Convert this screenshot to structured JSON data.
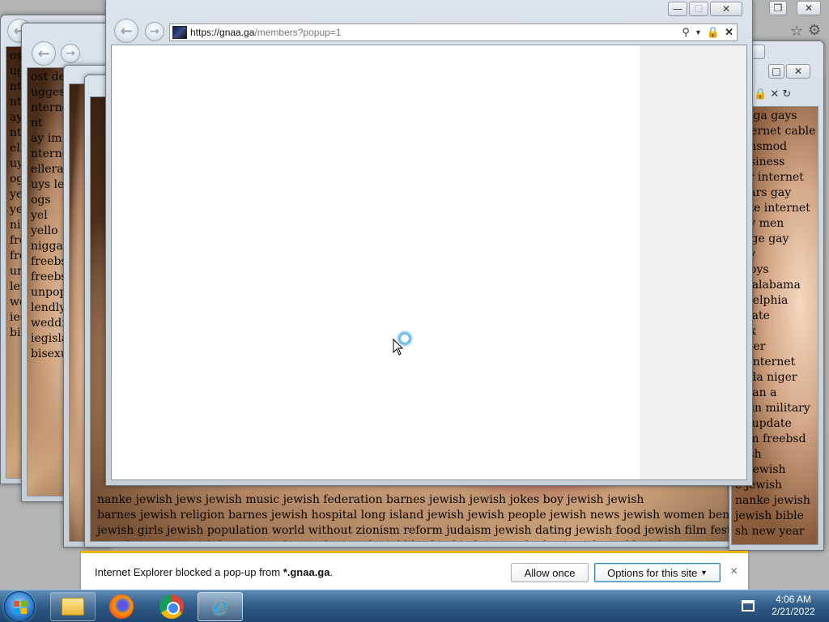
{
  "popup": {
    "url_host": "https://gnaa.ga",
    "url_path": "/members?popup=1",
    "caption": {
      "minimize": "—",
      "maximize": "☐",
      "close": "✕"
    }
  },
  "background_window": {
    "lines": [
      "nigga gays",
      "internet cable",
      "e insmod",
      "business",
      "ker internet",
      "bears gay",
      "note internet",
      "gay men",
      "riage gay",
      "gay",
      "y toys",
      "ay alabama",
      "ladelphia",
      "s hate",
      "nux",
      "niger",
      "st internet",
      "nada niger",
      "n can a",
      "ys in military",
      "sd update",
      "com freebsd",
      "wish",
      "al jewish",
      "e jewish",
      "nanke jewish",
      "jewish bible",
      "sh new year"
    ],
    "bottom_lines": [
      "nanke jewish jews jewish music jewish federation barnes jewish jewish jokes boy jewish jewish",
      "barnes jewish religion barnes jewish hospital long island jewish jewish people jewish news jewish women ben bernanke jewish",
      "jewish girls jewish population world without zionism reform judaism jewish dating jewish food jewish film festival jewish bible",
      "jewish names jewish last names bernanke jew daniel libeskind judaism orthodox jewish world without zionism jewish new year"
    ],
    "left_lines": [
      "ost de",
      "ugges",
      "nterne",
      "nt",
      "ay im",
      "nterne",
      "ellera",
      "uys le",
      "ogs",
      "yel",
      "yello",
      "nigga g",
      "freebs",
      "freebs",
      "unpopi",
      "lendly",
      "wedding",
      "iegislat",
      "bisexua"
    ]
  },
  "notification": {
    "message_prefix": "Internet Explorer blocked a pop-up from ",
    "message_domain": "*.gnaa.ga",
    "message_suffix": ".",
    "allow_once": "Allow once",
    "options": "Options for this site",
    "close": "×"
  },
  "taskbar": {
    "time": "4:06 AM",
    "date": "2/21/2022",
    "apps": [
      "windows-explorer",
      "firefox",
      "chrome",
      "internet-explorer"
    ]
  },
  "colors": {
    "notify_accent": "#f0b400",
    "taskbar": "#2e5a85"
  }
}
